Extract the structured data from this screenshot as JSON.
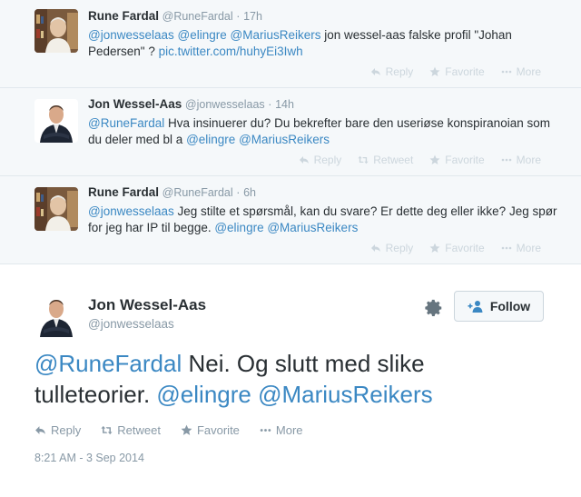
{
  "tweets": [
    {
      "fullname": "Rune Fardal",
      "screen": "@RuneFardal",
      "time": "17h",
      "text_segments": [
        {
          "t": "mention",
          "v": "@jonwesselaas"
        },
        {
          "t": "text",
          "v": " "
        },
        {
          "t": "mention",
          "v": "@elingre"
        },
        {
          "t": "text",
          "v": " "
        },
        {
          "t": "mention",
          "v": "@MariusReikers"
        },
        {
          "t": "text",
          "v": " jon wessel-aas falske profil \"Johan Pedersen\" ? "
        },
        {
          "t": "link",
          "v": "pic.twitter.com/huhyEi3Iwh"
        }
      ],
      "actions": [
        "Reply",
        "Favorite",
        "More"
      ]
    },
    {
      "fullname": "Jon Wessel-Aas",
      "screen": "@jonwesselaas",
      "time": "14h",
      "text_segments": [
        {
          "t": "mention",
          "v": "@RuneFardal"
        },
        {
          "t": "text",
          "v": " Hva insinuerer du? Du bekrefter bare den useriøse konspiranoian som du deler med bl a "
        },
        {
          "t": "mention",
          "v": "@elingre"
        },
        {
          "t": "text",
          "v": " "
        },
        {
          "t": "mention",
          "v": "@MariusReikers"
        }
      ],
      "actions": [
        "Reply",
        "Retweet",
        "Favorite",
        "More"
      ]
    },
    {
      "fullname": "Rune Fardal",
      "screen": "@RuneFardal",
      "time": "6h",
      "text_segments": [
        {
          "t": "mention",
          "v": "@jonwesselaas"
        },
        {
          "t": "text",
          "v": " Jeg stilte et spørsmål, kan du svare? Er dette deg eller ikke? Jeg spør for jeg har IP  til begge. "
        },
        {
          "t": "mention",
          "v": "@elingre"
        },
        {
          "t": "text",
          "v": " "
        },
        {
          "t": "mention",
          "v": "@MariusReikers"
        }
      ],
      "actions": [
        "Reply",
        "Favorite",
        "More"
      ]
    }
  ],
  "main": {
    "fullname": "Jon Wessel-Aas",
    "screen": "@jonwesselaas",
    "follow_label": "Follow",
    "text_segments": [
      {
        "t": "mention",
        "v": "@RuneFardal"
      },
      {
        "t": "text",
        "v": " Nei. Og slutt med slike tulleteorier. "
      },
      {
        "t": "mention",
        "v": "@elingre"
      },
      {
        "t": "text",
        "v": " "
      },
      {
        "t": "mention",
        "v": "@MariusReikers"
      }
    ],
    "actions": [
      "Reply",
      "Retweet",
      "Favorite",
      "More"
    ],
    "date": "8:21 AM - 3 Sep 2014"
  },
  "colors": {
    "link": "#3b88c3",
    "muted": "#8899a6",
    "action_faded": "#ccd6dd",
    "reply_bg": "#f5f8fa"
  }
}
